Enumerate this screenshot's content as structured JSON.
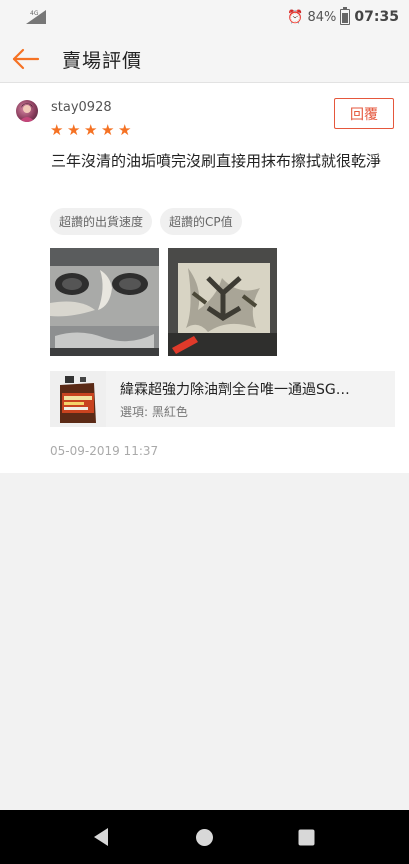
{
  "status_bar": {
    "network": "4G",
    "battery": "84%",
    "time": "07:35"
  },
  "app_bar": {
    "title": "賣場評價"
  },
  "review": {
    "username": "stay0928",
    "rating": 5,
    "rating_max": 5,
    "reply_label": "回覆",
    "text": "三年沒清的油垢噴完沒刷直接用抹布擦拭就很乾淨",
    "tags": [
      "超讚的出貨速度",
      "超讚的CP值"
    ],
    "product": {
      "name": "緯霖超強力除油劑全台唯一通過SG…",
      "option": "選項: 黑紅色"
    },
    "date": "05-09-2019 11:37"
  },
  "colors": {
    "accent": "#f57224",
    "reply": "#e5573c"
  }
}
